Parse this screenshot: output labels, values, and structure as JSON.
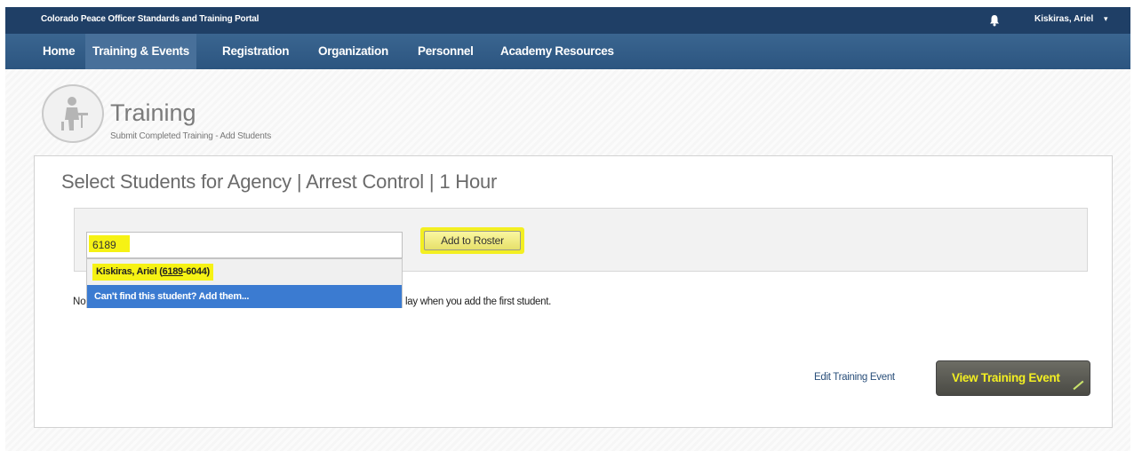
{
  "header": {
    "portal_title": "Colorado Peace Officer Standards and Training Portal",
    "user_name": "Kiskiras, Ariel",
    "bell_icon": "bell-icon",
    "user_caret": "▾"
  },
  "nav": {
    "items": [
      {
        "label": "Home",
        "active": false
      },
      {
        "label": "Training & Events",
        "active": true
      },
      {
        "label": "Registration",
        "active": false
      },
      {
        "label": "Organization",
        "active": false
      },
      {
        "label": "Personnel",
        "active": false
      },
      {
        "label": "Academy Resources",
        "active": false
      }
    ]
  },
  "page": {
    "title": "Training",
    "subtitle": "Submit Completed Training - Add Students",
    "logo_icon": "training-person-icon"
  },
  "card": {
    "heading": "Select Students for Agency | Arrest Control | 1 Hour"
  },
  "search": {
    "value": "6189",
    "add_button_label": "Add to Roster"
  },
  "dropdown": {
    "result_name": "Kiskiras, Ariel (",
    "result_match": "6189",
    "result_rest": "-6044)",
    "add_new_label": "Can't find this student? Add them..."
  },
  "roster": {
    "empty_prefix": "No",
    "empty_suffix": "lay when you add the first student."
  },
  "actions": {
    "edit_label": "Edit Training Event",
    "view_label": "View Training Event"
  },
  "colors": {
    "topbar": "#1f3f66",
    "navbar": "#2c5580",
    "highlight": "#f6f214",
    "dropdown_selected": "#3b7bd1"
  }
}
